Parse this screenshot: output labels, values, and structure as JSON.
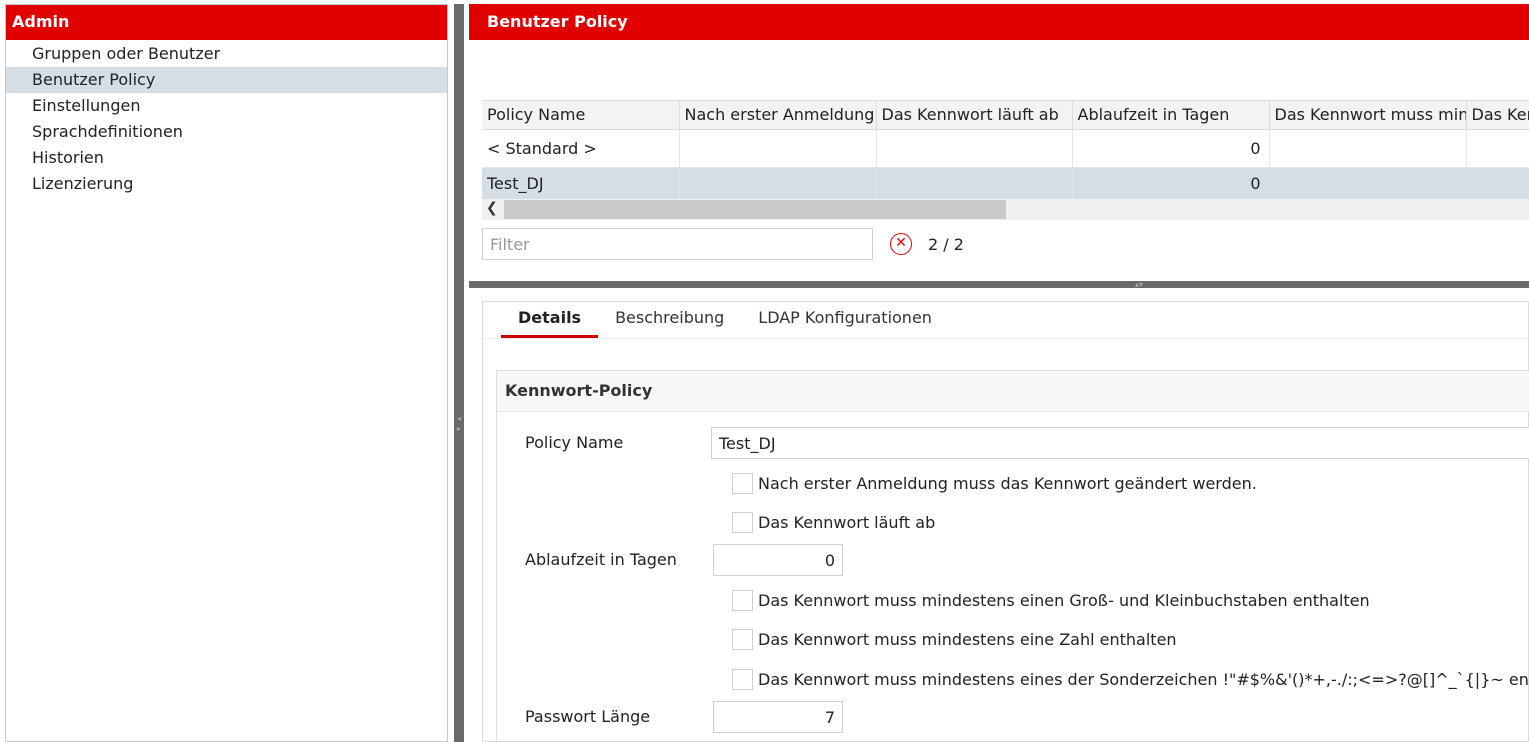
{
  "left_panel": {
    "title": "Admin",
    "nav_items": [
      {
        "label": "Gruppen oder Benutzer"
      },
      {
        "label": "Benutzer Policy"
      },
      {
        "label": "Einstellungen"
      },
      {
        "label": "Sprachdefinitionen"
      },
      {
        "label": "Historien"
      },
      {
        "label": "Lizenzierung"
      }
    ],
    "selected_item": "Benutzer Policy"
  },
  "right_panel": {
    "title": "Benutzer Policy",
    "table": {
      "columns": [
        "Policy Name",
        "Nach erster Anmeldung",
        "Das Kennwort läuft ab",
        "Ablaufzeit in Tagen",
        "Das Kennwort muss min",
        "Das Kennwort"
      ],
      "rows": [
        {
          "policy_name": "< Standard >",
          "nach_erster_anmeldung": "",
          "kennwort_laeuft_ab": "",
          "ablaufzeit": "0",
          "kennwort_muss_min": "",
          "kennwort": ""
        },
        {
          "policy_name": "Test_DJ",
          "nach_erster_anmeldung": "",
          "kennwort_laeuft_ab": "",
          "ablaufzeit": "0",
          "kennwort_muss_min": "",
          "kennwort": ""
        }
      ],
      "selected_row": "Test_DJ"
    },
    "filter": {
      "placeholder": "Filter",
      "value": "",
      "count": "2 / 2"
    },
    "tabs": [
      {
        "label": "Details",
        "active": true
      },
      {
        "label": "Beschreibung",
        "active": false
      },
      {
        "label": "LDAP Konfigurationen",
        "active": false
      }
    ],
    "section": {
      "title": "Kennwort-Policy",
      "policy_name_label": "Policy Name",
      "policy_name_value": "Test_DJ",
      "check_first_login": {
        "label": "Nach erster Anmeldung muss das Kennwort geändert werden.",
        "checked": false
      },
      "check_expires": {
        "label": "Das Kennwort läuft ab",
        "checked": false
      },
      "expiry_days_label": "Ablaufzeit in Tagen",
      "expiry_days_value": "0",
      "check_upper_lower": {
        "label": "Das Kennwort muss mindestens einen Groß- und Kleinbuchstaben enthalten",
        "checked": false
      },
      "check_digit": {
        "label": "Das Kennwort muss mindestens eine Zahl enthalten",
        "checked": false
      },
      "check_special": {
        "label": "Das Kennwort muss mindestens eines der Sonderzeichen !\"#$%&'()*+,-./:;<=>?@[]^_`{|}~ enthalten",
        "checked": false
      },
      "password_length_label": "Passwort Länge",
      "password_length_value": "7"
    }
  },
  "colors": {
    "accent_red": "#e00000",
    "selection_bg": "#d5dde5",
    "splitter": "#6a6a6a"
  },
  "icons": {
    "clear_filter": "clear-circle-x-icon",
    "scroll_left": "chevron-left-icon"
  }
}
